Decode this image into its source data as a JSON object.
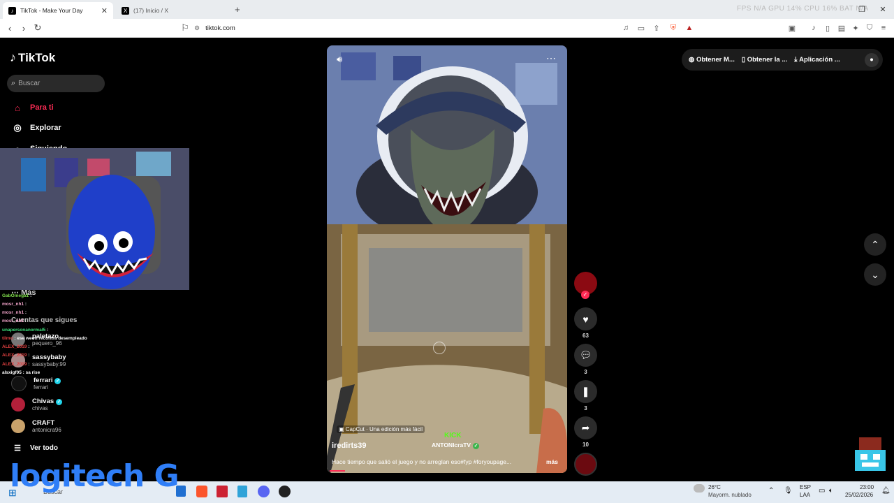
{
  "browser": {
    "tabs": [
      {
        "title": "TikTok - Make Your Day",
        "active": true
      },
      {
        "title": "(17) Inicio / X",
        "active": false
      }
    ],
    "new_tab": "+",
    "stats": "FPS N/A   GPU 14%   CPU 16%   BAT N/A",
    "url": "tiktok.com"
  },
  "tiktok": {
    "logo": "TikTok",
    "search_placeholder": "Buscar",
    "nav": [
      {
        "label": "Para ti",
        "icon": "home-icon",
        "active": true
      },
      {
        "label": "Explorar",
        "icon": "compass-icon"
      },
      {
        "label": "Siguiendo",
        "icon": "people-icon"
      }
    ],
    "more": "Más",
    "following_heading": "Cuentas que sigues",
    "accounts": [
      {
        "name": "paletazo",
        "handle": "pequero_96"
      },
      {
        "name": "sassybaby",
        "handle": "sassybaby.99"
      },
      {
        "name": "ferrari",
        "handle": "ferrari",
        "verified": true
      },
      {
        "name": "Chivas",
        "handle": "chivas",
        "verified": true
      },
      {
        "name": "CRAFT",
        "handle": "antonicra96"
      }
    ],
    "see_all": "Ver todo",
    "top_buttons": [
      "Obtener M...",
      "Obtener la ...",
      "Aplicación ..."
    ]
  },
  "chat": [
    {
      "user": "GabOmega1",
      "msg": "",
      "color": "#7fdc4b"
    },
    {
      "user": "mosr_nh1",
      "msg": "",
      "color": "#f2a3c9"
    },
    {
      "user": "mosr_nh1",
      "msg": "",
      "color": "#f2a3c9"
    },
    {
      "user": "mosr_nh1",
      "msg": "",
      "color": "#f2a3c9"
    },
    {
      "user": "unapersonanormal5",
      "msg": "",
      "color": "#3ee07c"
    },
    {
      "user": "tilmo",
      "msg": "ese weon recontra desempleado",
      "color": "#e04040"
    },
    {
      "user": "ALEX_2019",
      "msg": "",
      "color": "#e04040"
    },
    {
      "user": "ALEX_2019",
      "msg": "",
      "color": "#e04040"
    },
    {
      "user": "ALEX_2019",
      "msg": "",
      "color": "#e04040"
    },
    {
      "user": "alsxigf05",
      "msg": "sa rise",
      "color": "#ffffff"
    }
  ],
  "video": {
    "capcut": "CapCut · Una edición más fácil",
    "kick": "KICK",
    "kick_channel": "ANTONIcraTV",
    "author": "iredirts39",
    "caption": "Hace tiempo que salió el juego y no arreglan eso#fyp #foryoupage...",
    "more": "más",
    "likes": "63",
    "comments": "3",
    "saves": "3",
    "shares": "10"
  },
  "taskbar": {
    "search": "Buscar",
    "weather_temp": "26°C",
    "weather_desc": "Mayorm. nublado",
    "lang1": "ESP",
    "lang2": "LAA",
    "time": "23:00",
    "date": "25/02/2026"
  },
  "overlay_logo": "logitech G"
}
